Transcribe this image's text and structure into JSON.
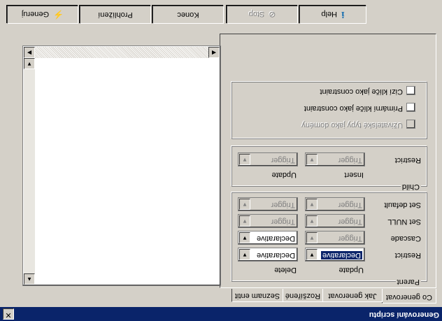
{
  "window": {
    "title": "Generování scriptu",
    "close_label": "✕"
  },
  "tabs": [
    "Co generovat",
    "Jak generovat",
    "Rozšířené",
    "Seznam entit"
  ],
  "options": {
    "check_foreign_keys": "Cizí klíče jako constraint",
    "check_primary_keys": "Primární klíče jako constraint",
    "check_user_types": "Uživatelské typy jako domény"
  },
  "child": {
    "title": "Child",
    "row_label": "Restrict",
    "col_insert": "Insert",
    "col_update": "Update",
    "insert_value": "Trigger",
    "update_value": "Trigger"
  },
  "parent": {
    "title": "Parent",
    "col_update": "Update",
    "col_delete": "Delete",
    "rows": [
      {
        "label": "Restrict",
        "update": "Declarative",
        "delete": "Declarative"
      },
      {
        "label": "Cascade",
        "update": "Trigger",
        "delete": "Declarative"
      },
      {
        "label": "Set NULL",
        "update": "Trigger",
        "delete": "Trigger"
      },
      {
        "label": "Set default",
        "update": "Trigger",
        "delete": "Trigger"
      }
    ]
  },
  "toolbar": {
    "generate": "Generuj",
    "browse": "Prohlížení",
    "end": "Konec",
    "stop": "Stop",
    "help": "Help"
  },
  "icons": {
    "generate": "lightning-icon",
    "stop": "stop-icon",
    "help": "info-icon"
  }
}
